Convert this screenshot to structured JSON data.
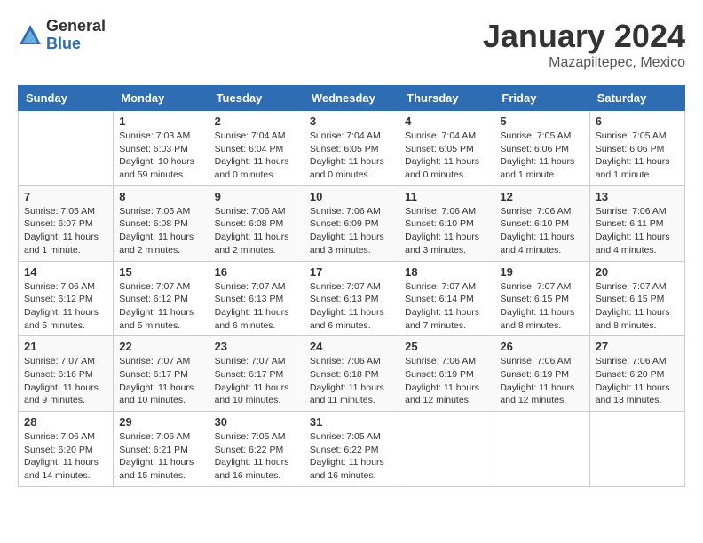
{
  "logo": {
    "general": "General",
    "blue": "Blue"
  },
  "title": {
    "month_year": "January 2024",
    "location": "Mazapiltepec, Mexico"
  },
  "days_of_week": [
    "Sunday",
    "Monday",
    "Tuesday",
    "Wednesday",
    "Thursday",
    "Friday",
    "Saturday"
  ],
  "weeks": [
    [
      {
        "day": "",
        "info": ""
      },
      {
        "day": "1",
        "info": "Sunrise: 7:03 AM\nSunset: 6:03 PM\nDaylight: 10 hours\nand 59 minutes."
      },
      {
        "day": "2",
        "info": "Sunrise: 7:04 AM\nSunset: 6:04 PM\nDaylight: 11 hours\nand 0 minutes."
      },
      {
        "day": "3",
        "info": "Sunrise: 7:04 AM\nSunset: 6:05 PM\nDaylight: 11 hours\nand 0 minutes."
      },
      {
        "day": "4",
        "info": "Sunrise: 7:04 AM\nSunset: 6:05 PM\nDaylight: 11 hours\nand 0 minutes."
      },
      {
        "day": "5",
        "info": "Sunrise: 7:05 AM\nSunset: 6:06 PM\nDaylight: 11 hours\nand 1 minute."
      },
      {
        "day": "6",
        "info": "Sunrise: 7:05 AM\nSunset: 6:06 PM\nDaylight: 11 hours\nand 1 minute."
      }
    ],
    [
      {
        "day": "7",
        "info": "Sunrise: 7:05 AM\nSunset: 6:07 PM\nDaylight: 11 hours\nand 1 minute."
      },
      {
        "day": "8",
        "info": "Sunrise: 7:05 AM\nSunset: 6:08 PM\nDaylight: 11 hours\nand 2 minutes."
      },
      {
        "day": "9",
        "info": "Sunrise: 7:06 AM\nSunset: 6:08 PM\nDaylight: 11 hours\nand 2 minutes."
      },
      {
        "day": "10",
        "info": "Sunrise: 7:06 AM\nSunset: 6:09 PM\nDaylight: 11 hours\nand 3 minutes."
      },
      {
        "day": "11",
        "info": "Sunrise: 7:06 AM\nSunset: 6:10 PM\nDaylight: 11 hours\nand 3 minutes."
      },
      {
        "day": "12",
        "info": "Sunrise: 7:06 AM\nSunset: 6:10 PM\nDaylight: 11 hours\nand 4 minutes."
      },
      {
        "day": "13",
        "info": "Sunrise: 7:06 AM\nSunset: 6:11 PM\nDaylight: 11 hours\nand 4 minutes."
      }
    ],
    [
      {
        "day": "14",
        "info": "Sunrise: 7:06 AM\nSunset: 6:12 PM\nDaylight: 11 hours\nand 5 minutes."
      },
      {
        "day": "15",
        "info": "Sunrise: 7:07 AM\nSunset: 6:12 PM\nDaylight: 11 hours\nand 5 minutes."
      },
      {
        "day": "16",
        "info": "Sunrise: 7:07 AM\nSunset: 6:13 PM\nDaylight: 11 hours\nand 6 minutes."
      },
      {
        "day": "17",
        "info": "Sunrise: 7:07 AM\nSunset: 6:13 PM\nDaylight: 11 hours\nand 6 minutes."
      },
      {
        "day": "18",
        "info": "Sunrise: 7:07 AM\nSunset: 6:14 PM\nDaylight: 11 hours\nand 7 minutes."
      },
      {
        "day": "19",
        "info": "Sunrise: 7:07 AM\nSunset: 6:15 PM\nDaylight: 11 hours\nand 8 minutes."
      },
      {
        "day": "20",
        "info": "Sunrise: 7:07 AM\nSunset: 6:15 PM\nDaylight: 11 hours\nand 8 minutes."
      }
    ],
    [
      {
        "day": "21",
        "info": "Sunrise: 7:07 AM\nSunset: 6:16 PM\nDaylight: 11 hours\nand 9 minutes."
      },
      {
        "day": "22",
        "info": "Sunrise: 7:07 AM\nSunset: 6:17 PM\nDaylight: 11 hours\nand 10 minutes."
      },
      {
        "day": "23",
        "info": "Sunrise: 7:07 AM\nSunset: 6:17 PM\nDaylight: 11 hours\nand 10 minutes."
      },
      {
        "day": "24",
        "info": "Sunrise: 7:06 AM\nSunset: 6:18 PM\nDaylight: 11 hours\nand 11 minutes."
      },
      {
        "day": "25",
        "info": "Sunrise: 7:06 AM\nSunset: 6:19 PM\nDaylight: 11 hours\nand 12 minutes."
      },
      {
        "day": "26",
        "info": "Sunrise: 7:06 AM\nSunset: 6:19 PM\nDaylight: 11 hours\nand 12 minutes."
      },
      {
        "day": "27",
        "info": "Sunrise: 7:06 AM\nSunset: 6:20 PM\nDaylight: 11 hours\nand 13 minutes."
      }
    ],
    [
      {
        "day": "28",
        "info": "Sunrise: 7:06 AM\nSunset: 6:20 PM\nDaylight: 11 hours\nand 14 minutes."
      },
      {
        "day": "29",
        "info": "Sunrise: 7:06 AM\nSunset: 6:21 PM\nDaylight: 11 hours\nand 15 minutes."
      },
      {
        "day": "30",
        "info": "Sunrise: 7:05 AM\nSunset: 6:22 PM\nDaylight: 11 hours\nand 16 minutes."
      },
      {
        "day": "31",
        "info": "Sunrise: 7:05 AM\nSunset: 6:22 PM\nDaylight: 11 hours\nand 16 minutes."
      },
      {
        "day": "",
        "info": ""
      },
      {
        "day": "",
        "info": ""
      },
      {
        "day": "",
        "info": ""
      }
    ]
  ]
}
